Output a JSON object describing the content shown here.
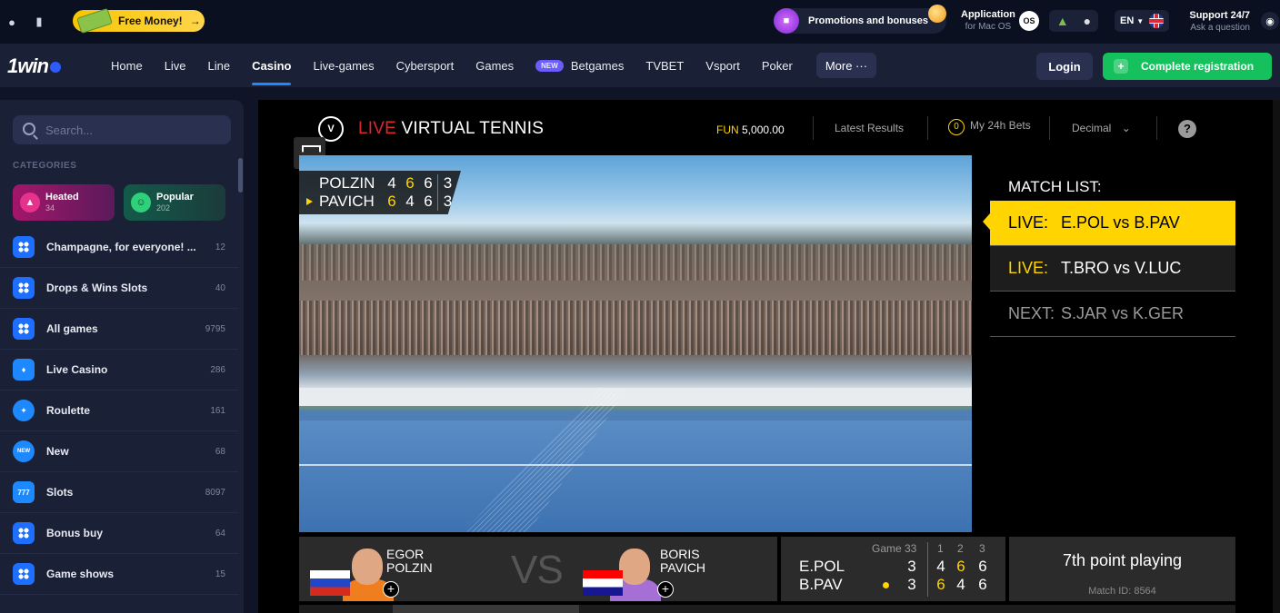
{
  "topbar": {
    "free_money": "Free Money!",
    "free_money_arrow": "→",
    "promotions": "Promotions and bonuses",
    "app_title": "Application",
    "app_sub": "for Mac OS",
    "os_badge": "OS",
    "lang": "EN",
    "support_title": "Support 24/7",
    "support_sub": "Ask a question"
  },
  "nav": {
    "logo": "1win",
    "items": [
      "Home",
      "Live",
      "Line",
      "Casino",
      "Live-games",
      "Cybersport",
      "Games",
      "Betgames",
      "TVBET",
      "Vsport",
      "Poker"
    ],
    "active": "Casino",
    "new_badge": "NEW",
    "more": "More ···",
    "login": "Login",
    "register": "Complete registration",
    "register_plus": "+"
  },
  "sidebar": {
    "search_placeholder": "Search...",
    "categories_label": "CATEGORIES",
    "cards": [
      {
        "label": "Heated",
        "count": "34"
      },
      {
        "label": "Popular",
        "count": "202"
      }
    ],
    "items": [
      {
        "label": "Champagne, for everyone! ...",
        "count": "12",
        "icon": "grid-icon"
      },
      {
        "label": "Drops & Wins Slots",
        "count": "40",
        "icon": "grid-icon"
      },
      {
        "label": "All games",
        "count": "9795",
        "icon": "grid-icon"
      },
      {
        "label": "Live Casino",
        "count": "286",
        "icon": "live-casino-icon"
      },
      {
        "label": "Roulette",
        "count": "161",
        "icon": "roulette-icon"
      },
      {
        "label": "New",
        "count": "68",
        "icon": "new-icon"
      },
      {
        "label": "Slots",
        "count": "8097",
        "icon": "slots-icon"
      },
      {
        "label": "Bonus buy",
        "count": "64",
        "icon": "grid-icon"
      },
      {
        "label": "Game shows",
        "count": "15",
        "icon": "grid-icon"
      }
    ]
  },
  "game": {
    "logo": "V",
    "title_live": "LIVE",
    "title_rest": " VIRTUAL TENNIS",
    "fun_currency": "FUN",
    "fun_amount": " 5,000.00",
    "latest_results": "Latest Results",
    "bets_count": "0",
    "my_bets": "My 24h Bets",
    "odds_format": "Decimal",
    "odds_chevron": "⌄",
    "help": "?",
    "scoreboard": [
      {
        "name": "POLZIN",
        "s1": "4",
        "s2": "6",
        "s3": "6",
        "total": "3"
      },
      {
        "name": "PAVICH",
        "s1": "6",
        "s2": "4",
        "s3": "6",
        "total": "3"
      }
    ],
    "match_list_title": "MATCH LIST:",
    "match_list": [
      {
        "status": "LIVE:",
        "match": "E.POL vs B.PAV"
      },
      {
        "status": "LIVE:",
        "match": "T.BRO vs V.LUC"
      },
      {
        "status": "NEXT:",
        "match": "S.JAR vs K.GER"
      }
    ],
    "player1_first": "EGOR",
    "player1_last": "POLZIN",
    "player2_first": "BORIS",
    "player2_last": "PAVICH",
    "vs": "VS",
    "add_symbol": "+",
    "score_header": "Game 33",
    "score_sets": [
      "1",
      "2",
      "3"
    ],
    "score_rows": [
      {
        "name": "E.POL",
        "game": "3",
        "s1": "4",
        "s2": "6",
        "s3": "6"
      },
      {
        "name": "B.PAV",
        "game": "3",
        "s1": "6",
        "s2": "4",
        "s3": "6"
      }
    ],
    "status_main": "7th point playing",
    "match_id": "Match ID: 8564"
  }
}
